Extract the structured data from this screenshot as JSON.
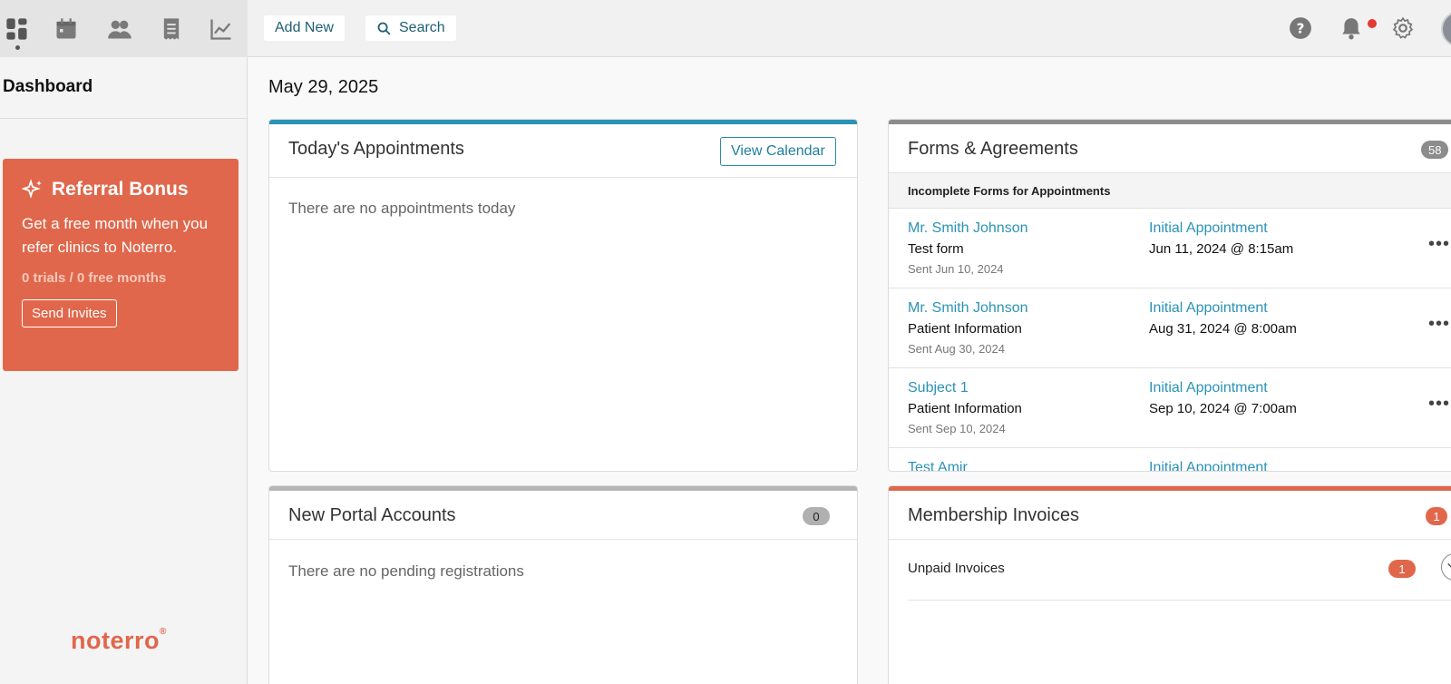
{
  "topbar": {
    "add_new_label": "Add New",
    "search_label": "Search",
    "nav_icons": [
      "dashboard-icon",
      "calendar-icon",
      "people-icon",
      "receipt-icon",
      "chart-icon"
    ],
    "right_icons": [
      "help-icon",
      "bell-icon",
      "gear-icon"
    ]
  },
  "sidebar": {
    "title": "Dashboard",
    "referral": {
      "title": "Referral Bonus",
      "text": "Get a free month when you refer clinics to Noterro.",
      "stats": "0 trials / 0 free months",
      "button_label": "Send Invites"
    },
    "brand": "noterro"
  },
  "main": {
    "date": "May 29, 2025",
    "appointments": {
      "title": "Today's Appointments",
      "button_label": "View Calendar",
      "empty_text": "There are no appointments today"
    },
    "forms": {
      "title": "Forms & Agreements",
      "count": "58",
      "subheader": "Incomplete Forms for Appointments",
      "rows": [
        {
          "name": "Mr. Smith Johnson",
          "form": "Test form",
          "sent": "Sent Jun 10, 2024",
          "appointment": "Initial Appointment",
          "date": "Jun 11, 2024 @ 8:15am"
        },
        {
          "name": "Mr. Smith Johnson",
          "form": "Patient Information",
          "sent": "Sent Aug 30, 2024",
          "appointment": "Initial Appointment",
          "date": "Aug 31, 2024 @ 8:00am"
        },
        {
          "name": "Subject 1",
          "form": "Patient Information",
          "sent": "Sent Sep 10, 2024",
          "appointment": "Initial Appointment",
          "date": "Sep 10, 2024 @ 7:00am"
        },
        {
          "name": "Test Amir",
          "form": "",
          "sent": "",
          "appointment": "Initial Appointment",
          "date": ""
        }
      ]
    },
    "portal": {
      "title": "New Portal Accounts",
      "count": "0",
      "empty_text": "There are no pending registrations"
    },
    "invoices": {
      "title": "Membership Invoices",
      "count": "1",
      "row_label": "Unpaid Invoices",
      "row_count": "1"
    }
  },
  "colors": {
    "accent_blue": "#2b93b5",
    "brand_orange": "#e0674b",
    "appointments_bar": "#2b93b5",
    "forms_bar": "#8c8c8c",
    "portal_bar": "#b5b5b5",
    "invoices_bar": "#e0674b"
  }
}
